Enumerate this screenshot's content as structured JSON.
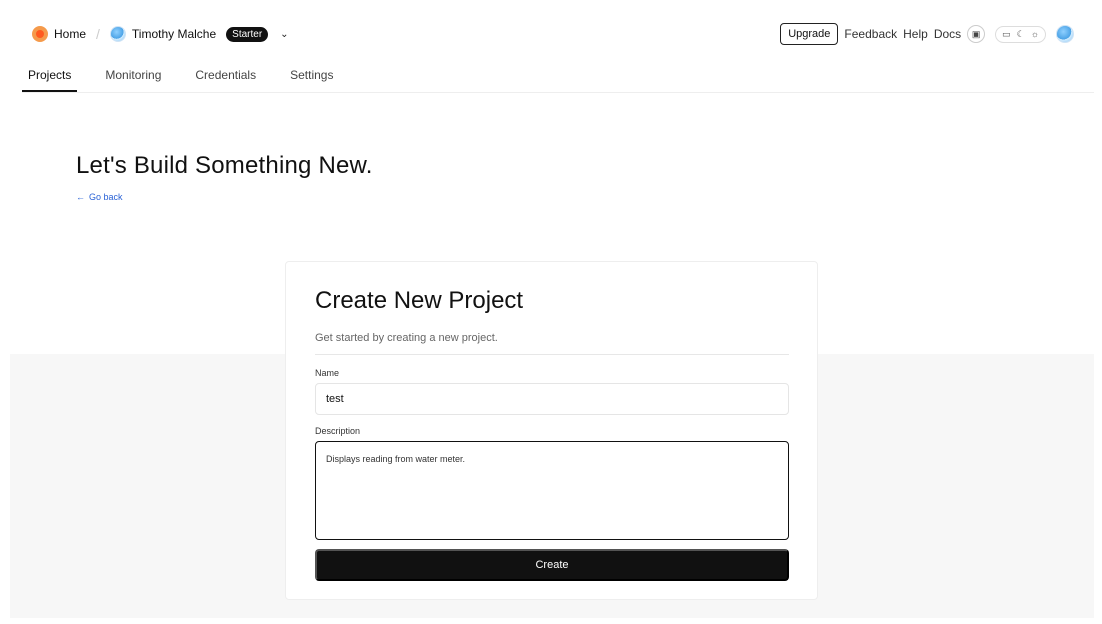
{
  "header": {
    "home_label": "Home",
    "user_name": "Timothy Malche",
    "plan_badge": "Starter",
    "chevron_icon": "chevron-down",
    "upgrade_label": "Upgrade",
    "links": [
      "Feedback",
      "Help",
      "Docs"
    ],
    "theme_icons": [
      "monitor-icon",
      "moon-icon",
      "sun-icon"
    ]
  },
  "nav": {
    "tabs": [
      {
        "label": "Projects",
        "active": true
      },
      {
        "label": "Monitoring",
        "active": false
      },
      {
        "label": "Credentials",
        "active": false
      },
      {
        "label": "Settings",
        "active": false
      }
    ]
  },
  "page": {
    "title": "Let's Build Something New.",
    "go_back": "Go back"
  },
  "card": {
    "title": "Create New Project",
    "subtitle": "Get started by creating a new project.",
    "name_label": "Name",
    "name_value": "test",
    "description_label": "Description",
    "description_value": "Displays reading from water meter.",
    "create_label": "Create"
  }
}
